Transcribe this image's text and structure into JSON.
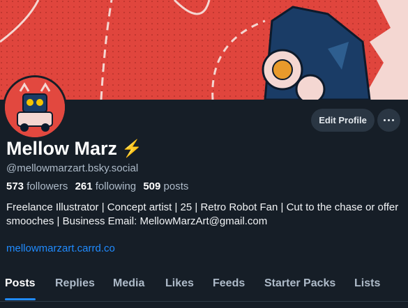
{
  "profile": {
    "display_name": "Mellow Marz",
    "name_emoji": "⚡",
    "handle": "@mellowmarzart.bsky.social",
    "followers_count": "573",
    "followers_label": "followers",
    "following_count": "261",
    "following_label": "following",
    "posts_count": "509",
    "posts_label": "posts",
    "bio": "Freelance Illustrator | Concept artist | 25 | Retro Robot Fan | Cut to the chase or offer smooches | Business Email: MellowMarzArt@gmail.com",
    "link": "mellowmarzart.carrd.co"
  },
  "actions": {
    "edit_profile": "Edit Profile",
    "more_icon": "ellipsis-icon"
  },
  "tabs": [
    "Posts",
    "Replies",
    "Media",
    "Likes",
    "Feeds",
    "Starter Packs",
    "Lists"
  ],
  "active_tab": "Posts",
  "colors": {
    "background": "#161e27",
    "banner_red": "#e0453d",
    "accent": "#208bfe",
    "secondary_text": "#aebbc9",
    "button_bg": "#2a3643"
  }
}
